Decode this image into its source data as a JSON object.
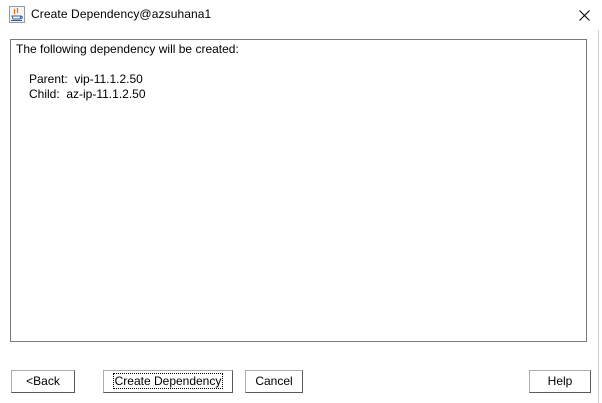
{
  "window": {
    "title": "Create Dependency@azsuhana1",
    "icon": "java-app-icon",
    "close_icon": "close-icon"
  },
  "content": {
    "heading": "The following dependency will be created:",
    "parent_line": "Parent:  vip-11.1.2.50",
    "child_line": "Child:  az-ip-11.1.2.50"
  },
  "buttons": {
    "back": "<Back",
    "create_dependency": "Create Dependency",
    "cancel": "Cancel",
    "help": "Help"
  }
}
